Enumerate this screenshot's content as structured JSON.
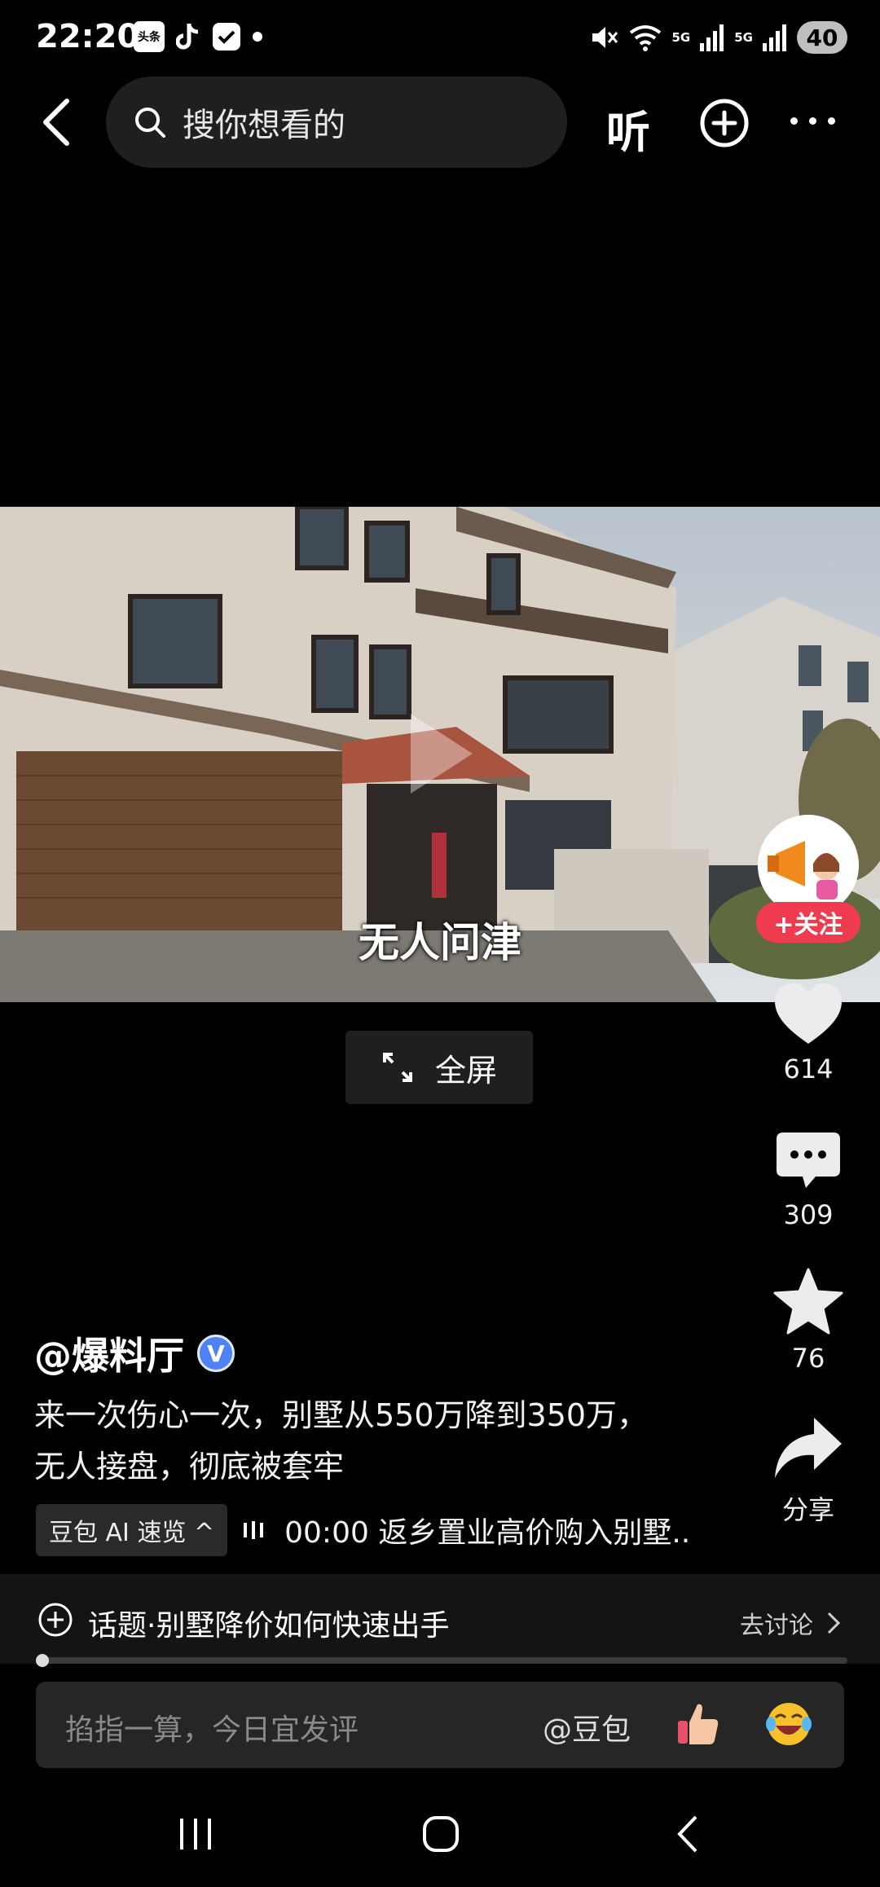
{
  "status_bar": {
    "time": "22:20",
    "app_badge_text": "头条",
    "battery": "40",
    "network_1": "5G",
    "network_2": "5G"
  },
  "top_nav": {
    "search_placeholder": "搜你想看的",
    "listen_label": "听"
  },
  "video": {
    "subtitle": "无人问津"
  },
  "fullscreen_label": "全屏",
  "rail": {
    "follow_label": "+关注",
    "likes": "614",
    "comments": "309",
    "favorites": "76",
    "share_label": "分享"
  },
  "post": {
    "author": "@爆料厅",
    "verified_mark": "V",
    "description_line1": "来一次伤心一次，别墅从550万降到350万，",
    "description_line2": "无人接盘，彻底被套牢",
    "ai_chip_label": "豆包 AI 速览 ^",
    "ai_summary": "00:00 返乡置业高价购入别墅.."
  },
  "topic": {
    "label": "话题·别墅降价如何快速出手",
    "action": "去讨论"
  },
  "comment_bar": {
    "placeholder": "掐指一算，今日宜发评",
    "mention": "@豆包"
  }
}
